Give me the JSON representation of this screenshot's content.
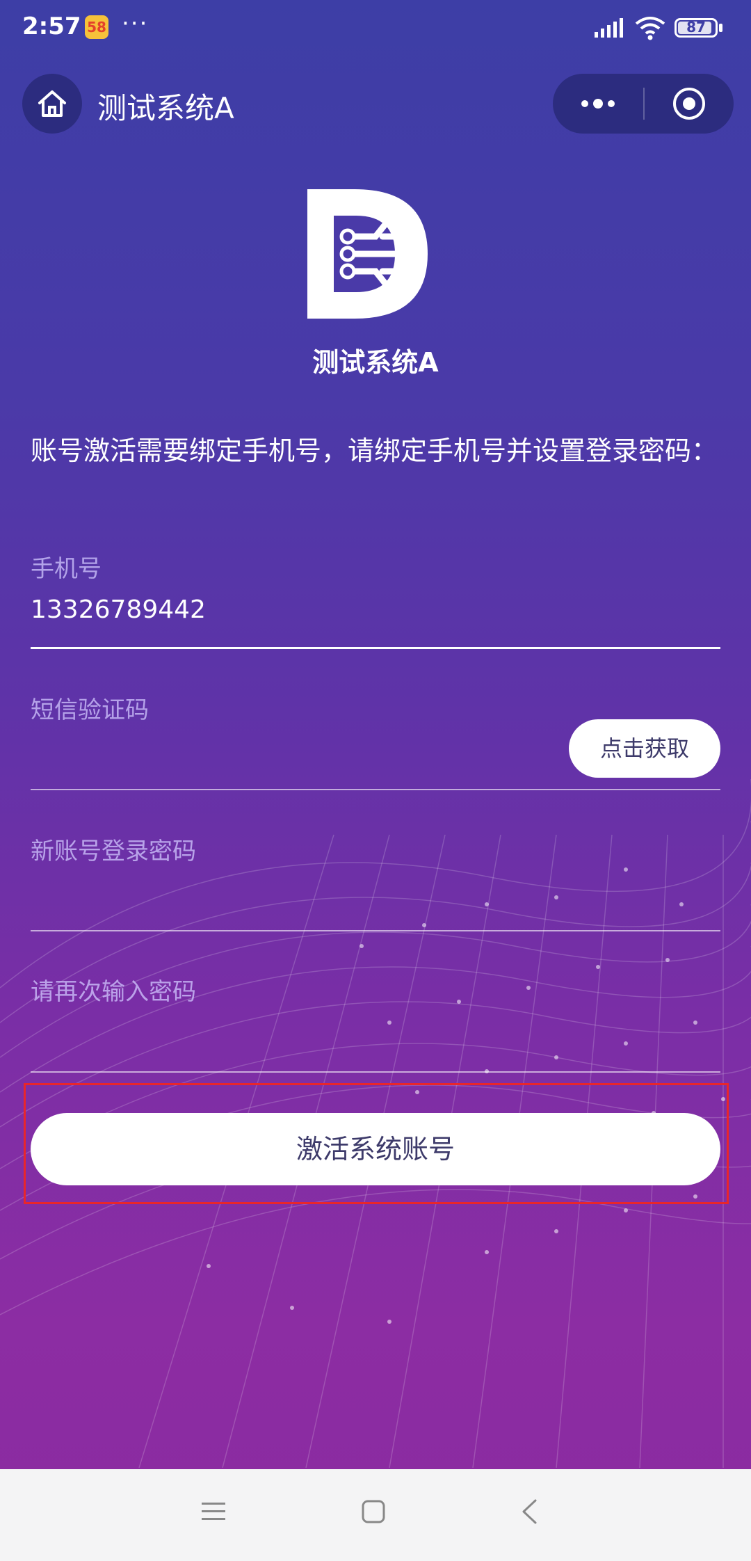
{
  "status": {
    "time": "2:57",
    "app_badge": "58",
    "more": "···",
    "battery": "87"
  },
  "nav": {
    "title": "测试系统A"
  },
  "logo": {
    "name": "测试系统A"
  },
  "instruction": "账号激活需要绑定手机号，请绑定手机号并设置登录密码：",
  "form": {
    "phone": {
      "label": "手机号",
      "value": "13326789442"
    },
    "sms": {
      "label": "短信验证码",
      "button": "点击获取"
    },
    "password": {
      "label": "新账号登录密码"
    },
    "confirm": {
      "label": "请再次输入密码"
    }
  },
  "activate_button": "激活系统账号",
  "colors": {
    "accent_red": "#e8262b",
    "bg_top": "#3d3ea6",
    "bg_bottom": "#8a2aa0"
  }
}
